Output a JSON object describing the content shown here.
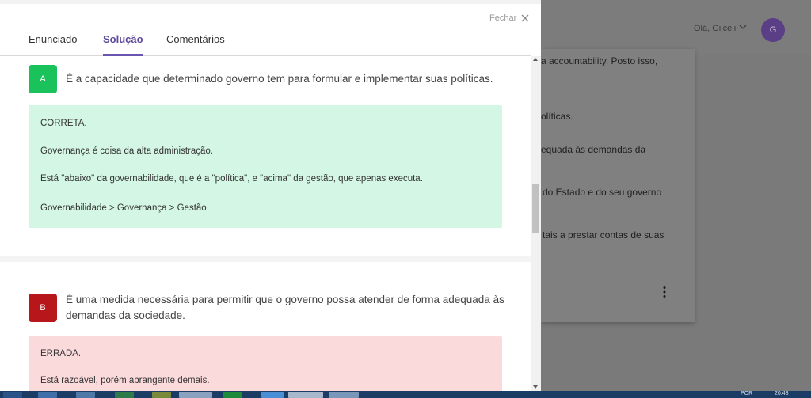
{
  "background": {
    "greeting": "Olá, Gilcéli",
    "avatar_initial": "G",
    "fragments": [
      "a accountability. Posto isso,",
      "olíticas.",
      "equada às demandas da",
      "do Estado e do seu governo",
      "tais a prestar contas de suas"
    ]
  },
  "modal": {
    "close_label": "Fechar",
    "tabs": [
      {
        "label": "Enunciado",
        "active": false
      },
      {
        "label": "Solução",
        "active": true
      },
      {
        "label": "Comentários",
        "active": false
      }
    ],
    "options": [
      {
        "letter": "A",
        "text": "É a capacidade que determinado governo tem para formular e implementar suas políticas.",
        "verdict": "CORRETA.",
        "explanation": [
          "Governança é coisa da alta administração.",
          "Está \"abaixo\" da governabilidade, que é a \"política\", e \"acima\" da gestão, que apenas executa.",
          "Governabilidade > Governança > Gestão"
        ]
      },
      {
        "letter": "B",
        "text_line1": "É uma medida necessária para permitir que o governo possa atender de forma adequada às",
        "text_line2": "demandas da sociedade.",
        "verdict": "ERRADA.",
        "explanation": [
          "Está razoável, porém abrangente demais."
        ]
      }
    ]
  },
  "colors": {
    "accent": "#6a55b0",
    "correct_badge": "#19c25a",
    "wrong_badge": "#b7171b",
    "correct_box": "#d4f6e4",
    "wrong_box": "#fbdadc"
  },
  "taskbar": {
    "lang": "POR",
    "time": "20:43"
  }
}
